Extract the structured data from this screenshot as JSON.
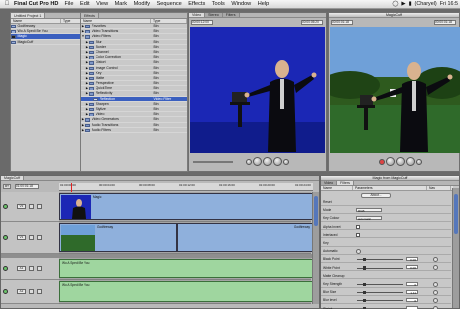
{
  "menubar": {
    "app_name": "Final Cut Pro HD",
    "items": [
      "File",
      "Edit",
      "View",
      "Mark",
      "Modify",
      "Sequence",
      "Effects",
      "Tools",
      "Window",
      "Help"
    ],
    "user": "(Charyel)",
    "clock": "Fri 16:5"
  },
  "browser": {
    "tabs": [
      "Untitled Project 1",
      "Effects"
    ],
    "header_name": "Name",
    "header_type": "Type",
    "items": [
      {
        "name": "Godfireway"
      },
      {
        "name": "Wo A Spedi Be You"
      },
      {
        "name": "Magic"
      },
      {
        "name": "MagicCuff"
      }
    ],
    "effects": [
      {
        "name": "Favorites",
        "type": "Bin",
        "open": false
      },
      {
        "name": "Video Transitions",
        "type": "Bin",
        "open": false
      },
      {
        "name": "Video Filters",
        "type": "Bin",
        "open": true
      },
      {
        "name": "Blur",
        "type": "Bin",
        "indent": 1
      },
      {
        "name": "Border",
        "type": "Bin",
        "indent": 1
      },
      {
        "name": "Channel",
        "type": "Bin",
        "indent": 1
      },
      {
        "name": "Color Correction",
        "type": "Bin",
        "indent": 1
      },
      {
        "name": "Distort",
        "type": "Bin",
        "indent": 1
      },
      {
        "name": "Image Control",
        "type": "Bin",
        "indent": 1
      },
      {
        "name": "Key",
        "type": "Bin",
        "indent": 1
      },
      {
        "name": "Matte",
        "type": "Bin",
        "indent": 1
      },
      {
        "name": "Perspective",
        "type": "Bin",
        "indent": 1
      },
      {
        "name": "QuickTime",
        "type": "Bin",
        "indent": 1
      },
      {
        "name": "Reflectivity",
        "type": "Bin",
        "indent": 1
      },
      {
        "name": "Reflection",
        "type": "Video Filter",
        "indent": 2,
        "selected": true
      },
      {
        "name": "Sharpen",
        "type": "Bin",
        "indent": 1
      },
      {
        "name": "Stylize",
        "type": "Bin",
        "indent": 1
      },
      {
        "name": "Video",
        "type": "Bin",
        "indent": 1
      },
      {
        "name": "Video Generators",
        "type": "Bin",
        "open": false
      },
      {
        "name": "Audio Transitions",
        "type": "Bin",
        "open": false
      },
      {
        "name": "Audio Filters",
        "type": "Bin",
        "open": false
      }
    ]
  },
  "viewer": {
    "tabs": [
      "Video",
      "Stereo",
      "Filters"
    ],
    "timecode_left": "00:00:12:00",
    "timecode_right": "00:00:05:20"
  },
  "canvas": {
    "title": "MagicCuff",
    "timecode_left": "00:00:01:18",
    "timecode_right": "00:00:01:18"
  },
  "timeline": {
    "tab": "MagicCuff",
    "sequence_label": "RT",
    "timecode": "01:00:01:18",
    "ruler": [
      "01:00:00:00",
      "00:00:04:00",
      "00:00:08:00",
      "01:00:12:00",
      "01:00:16:00",
      "01:00:20:00",
      "01:00:24:00"
    ],
    "tracks": [
      "V2",
      "V1",
      "A1",
      "A2"
    ],
    "clips": {
      "v2": "Magic",
      "v1_left": "Godfireway",
      "v1_right": "Godfireway",
      "a1": "Wo A Spedi Be You",
      "a2": "Wo A Spedi Be You"
    }
  },
  "filters_panel": {
    "title": "Magic from MagicCuff",
    "tabs": [
      "Video",
      "Filters"
    ],
    "col_name": "Name",
    "col_params": "Parameters",
    "col_nav": "Nav",
    "about": "About...",
    "params": [
      {
        "name": "Reset",
        "kind": "text"
      },
      {
        "name": "Mode",
        "kind": "popup",
        "value": "RGB"
      },
      {
        "name": "Key Colour",
        "kind": "popup",
        "value": "automatic"
      },
      {
        "name": "Alpha Invert",
        "kind": "check"
      },
      {
        "name": "Interlaced",
        "kind": "check"
      },
      {
        "name": "Key",
        "kind": "text"
      },
      {
        "name": "Automatic",
        "kind": "x"
      },
      {
        "name": "Black Point",
        "kind": "slider",
        "value": "0.00"
      },
      {
        "name": "White Point",
        "kind": "slider",
        "value": "0.00"
      },
      {
        "name": "Matte Cleanup",
        "kind": "text"
      },
      {
        "name": "Key Strength",
        "kind": "slider",
        "value": "0"
      },
      {
        "name": "Blur Size",
        "kind": "slider",
        "value": "1.11"
      },
      {
        "name": "Blur level",
        "kind": "slider",
        "value": "0"
      },
      {
        "name": "Shrink",
        "kind": "slider",
        "value": ""
      }
    ]
  },
  "colors": {
    "bluescreen": "#1b27b5",
    "selection": "#3a5fbf",
    "video_clip": "#8fb0dc",
    "audio_clip": "#9fd69f"
  }
}
